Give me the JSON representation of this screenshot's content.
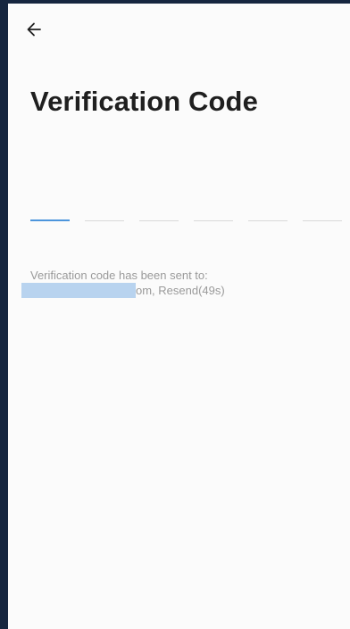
{
  "header": {
    "back_icon": "arrow-left-icon"
  },
  "page": {
    "title": "Verification Code"
  },
  "code_input": {
    "length": 6,
    "active_index": 0
  },
  "info": {
    "sent_text": "Verification code has been sent to:",
    "email_suffix": "om,",
    "resend_label": "Resend(49s)"
  },
  "colors": {
    "accent": "#4c95dc",
    "title_text": "#1f1f1f",
    "muted_text": "#9a9a9a",
    "background": "#fbfbfb",
    "frame": "#16263f",
    "redaction": "#b8d3ef"
  }
}
